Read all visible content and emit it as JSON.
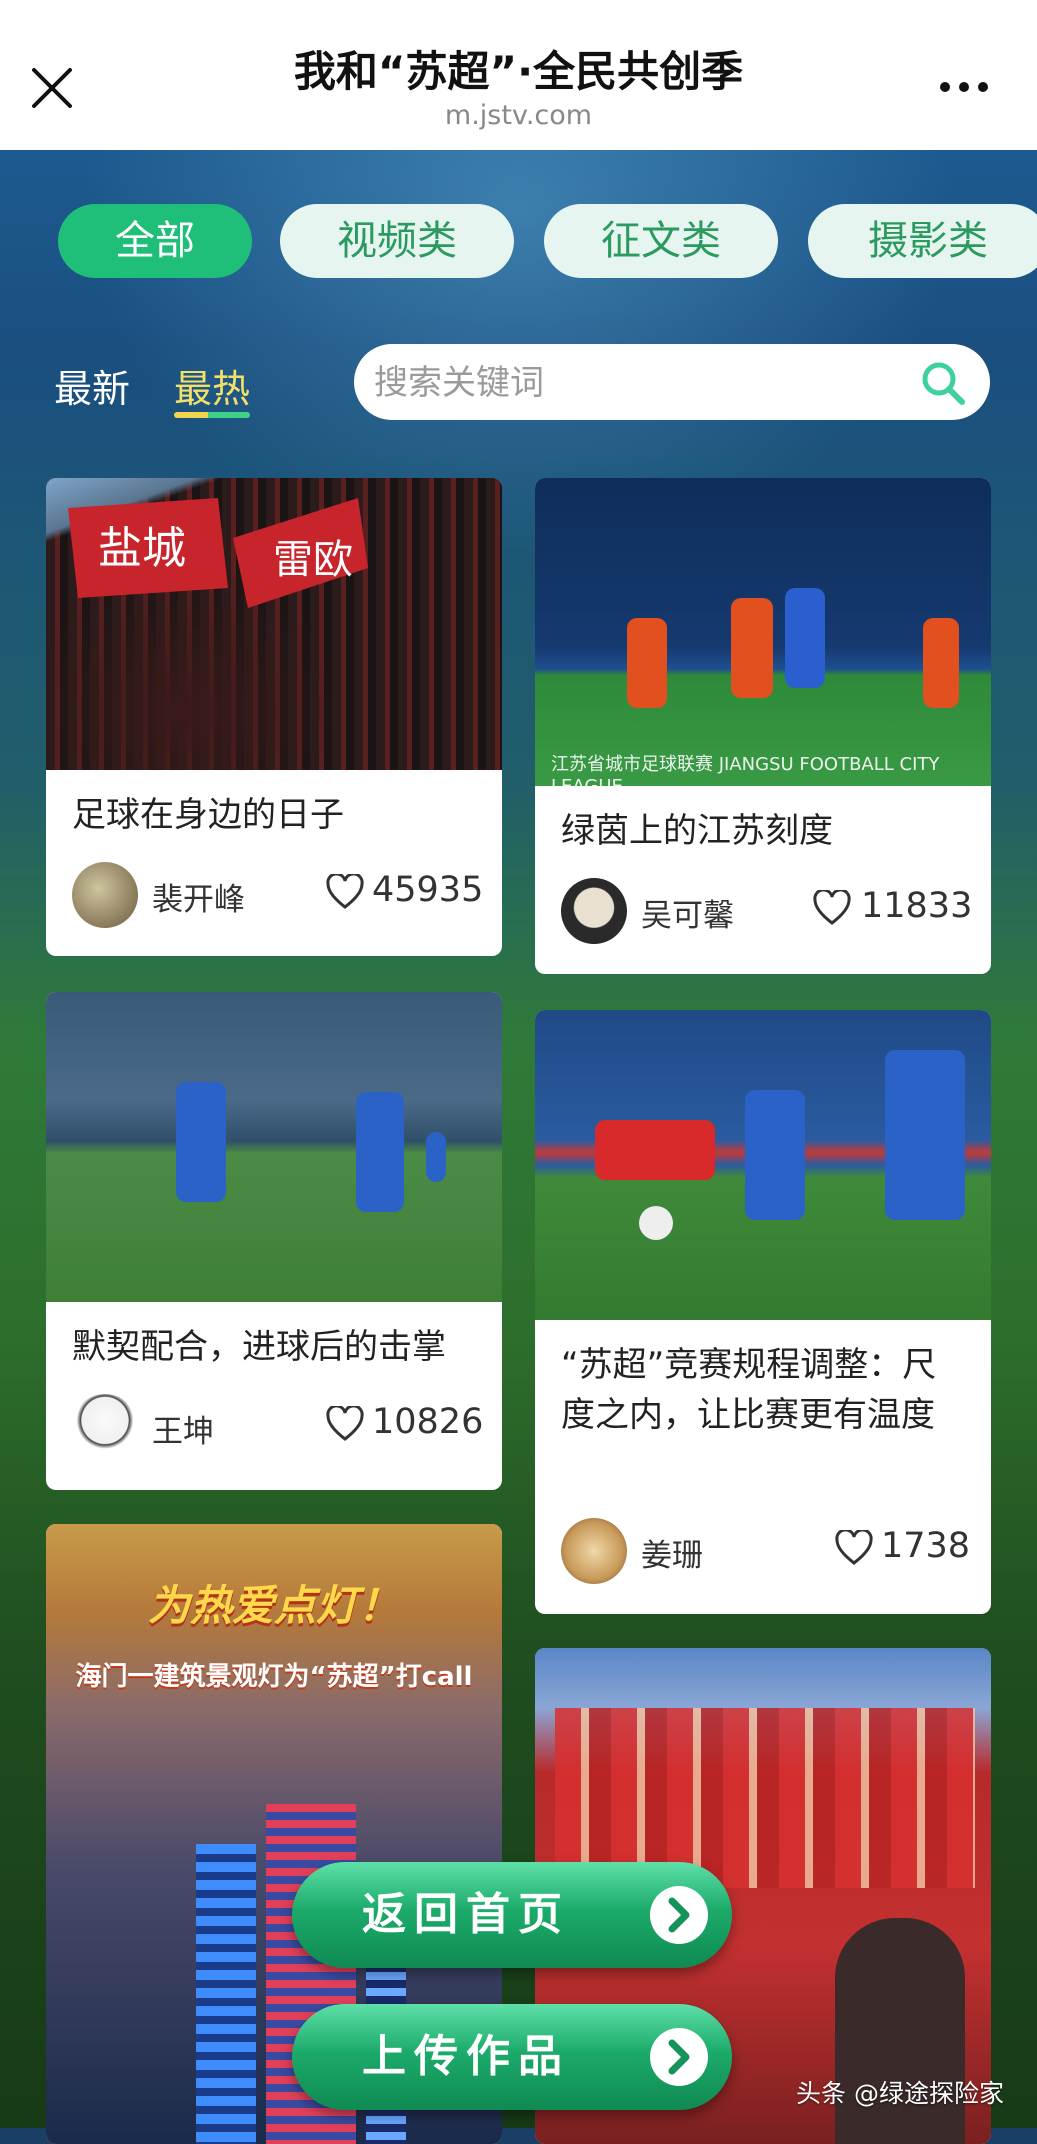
{
  "header": {
    "title": "我和“苏超”·全民共创季",
    "url": "m.jstv.com"
  },
  "tabs": [
    {
      "label": "全部",
      "active": true
    },
    {
      "label": "视频类",
      "active": false
    },
    {
      "label": "征文类",
      "active": false
    },
    {
      "label": "摄影类",
      "active": false
    }
  ],
  "sort": {
    "latest": "最新",
    "hottest": "最热",
    "active": "hottest"
  },
  "search": {
    "placeholder": "搜索关键词"
  },
  "cards": [
    {
      "title": "足球在身边的日子",
      "author": "裴开峰",
      "likes": "45935",
      "image": "fans-with-banners",
      "banner_text": [
        "盐城",
        "雷欧"
      ]
    },
    {
      "title": "绿茵上的江苏刻度",
      "author": "吴可馨",
      "likes": "11833",
      "image": "match-heading",
      "overlay_text": "江苏省城市足球联赛 JIANGSU FOOTBALL CITY LEAGUE"
    },
    {
      "title": "默契配合，进球后的击掌",
      "author": "王坤",
      "likes": "10826",
      "image": "high-five"
    },
    {
      "title": "“苏超”竞赛规程调整：尺度之内，让比赛更有温度",
      "author": "姜珊",
      "likes": "1738",
      "image": "tackle"
    },
    {
      "title": "",
      "image": "building-lights",
      "promo_title": "为热爱点灯！",
      "promo_subtitle": "海门一建筑景观灯为“苏超”打call"
    },
    {
      "title": "",
      "image": "crowd-celebration"
    }
  ],
  "buttons": {
    "home": "返回首页",
    "upload": "上传作品"
  },
  "watermark": "头条 @绿途探险家",
  "colors": {
    "accent": "#1fbf79",
    "tab_bg": "#e6f5ef",
    "tab_text": "#2b9a5e",
    "sort_active": "#f3e06a"
  }
}
